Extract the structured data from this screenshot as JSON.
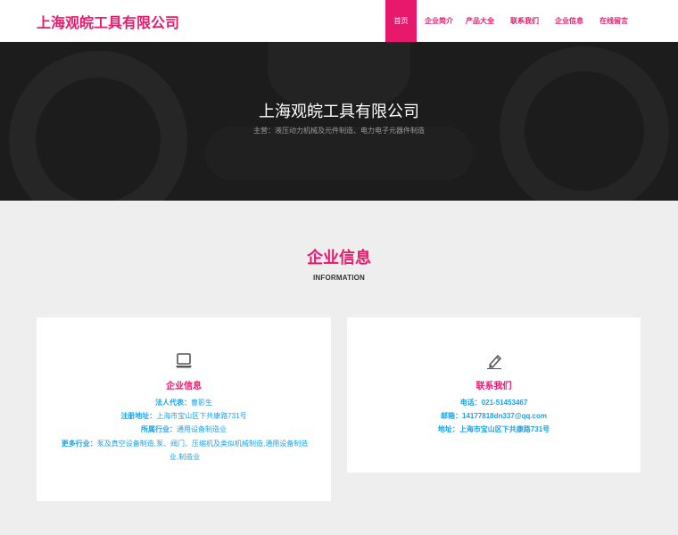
{
  "header": {
    "logo": "上海观皖工具有限公司",
    "nav": [
      "首页",
      "企业简介",
      "产品大全",
      "联系我们",
      "企业信息",
      "在线留言"
    ]
  },
  "banner": {
    "title": "上海观皖工具有限公司",
    "subtitle": "主营：液压动力机械及元件制造、电力电子元器件制造"
  },
  "section": {
    "title": "企业信息",
    "subtitle": "INFORMATION"
  },
  "company_card": {
    "icon": "laptop-icon",
    "heading": "企业信息",
    "rows": [
      {
        "label": "法人代表：",
        "value": "曹影生"
      },
      {
        "label": "注册地址：",
        "value": "上海市宝山区下共康路731号"
      },
      {
        "label": "所属行业：",
        "value": "通用设备制造业"
      },
      {
        "label": "更多行业：",
        "value": "泵及真空设备制造,泵、阀门、压缩机及类似机械制造,通用设备制造业,制造业"
      }
    ]
  },
  "contact_card": {
    "icon": "pencil-icon",
    "heading": "联系我们",
    "rows": [
      {
        "label": "电话：",
        "value": "021-51453467"
      },
      {
        "label": "邮箱：",
        "value": "14177818dn337@qq.com"
      },
      {
        "label": "地址：",
        "value": "上海市宝山区下共康路731号"
      }
    ]
  },
  "colors": {
    "brand": "#e8196d",
    "info_text": "#1aa3e8",
    "banner_bg": "#1c1c1c",
    "page_bg": "#eeeeee"
  }
}
